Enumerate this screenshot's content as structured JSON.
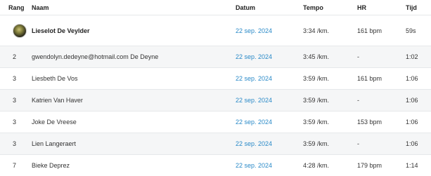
{
  "columns": {
    "rank": "Rang",
    "name": "Naam",
    "date": "Datum",
    "tempo": "Tempo",
    "hr": "HR",
    "time": "Tijd"
  },
  "rows": [
    {
      "rank": "",
      "rank_is_avatar": true,
      "name": "Lieselot De Veylder",
      "date": "22 sep. 2024",
      "tempo": "3:34 /km.",
      "hr": "161 bpm",
      "time": "59s"
    },
    {
      "rank": "2",
      "name": "gwendolyn.dedeyne@hotmail.com De Deyne",
      "date": "22 sep. 2024",
      "tempo": "3:45 /km.",
      "hr": "-",
      "time": "1:02"
    },
    {
      "rank": "3",
      "name": "Liesbeth De Vos",
      "date": "22 sep. 2024",
      "tempo": "3:59 /km.",
      "hr": "161 bpm",
      "time": "1:06"
    },
    {
      "rank": "3",
      "name": "Katrien Van Haver",
      "date": "22 sep. 2024",
      "tempo": "3:59 /km.",
      "hr": "-",
      "time": "1:06"
    },
    {
      "rank": "3",
      "name": "Joke De Vreese",
      "date": "22 sep. 2024",
      "tempo": "3:59 /km.",
      "hr": "153 bpm",
      "time": "1:06"
    },
    {
      "rank": "3",
      "name": "Lien Langeraert",
      "date": "22 sep. 2024",
      "tempo": "3:59 /km.",
      "hr": "-",
      "time": "1:06"
    },
    {
      "rank": "7",
      "name": "Bieke Deprez",
      "date": "22 sep. 2024",
      "tempo": "4:28 /km.",
      "hr": "179 bpm",
      "time": "1:14"
    }
  ],
  "colors": {
    "link": "#2a8ac8",
    "alt_row": "#f5f6f7"
  }
}
